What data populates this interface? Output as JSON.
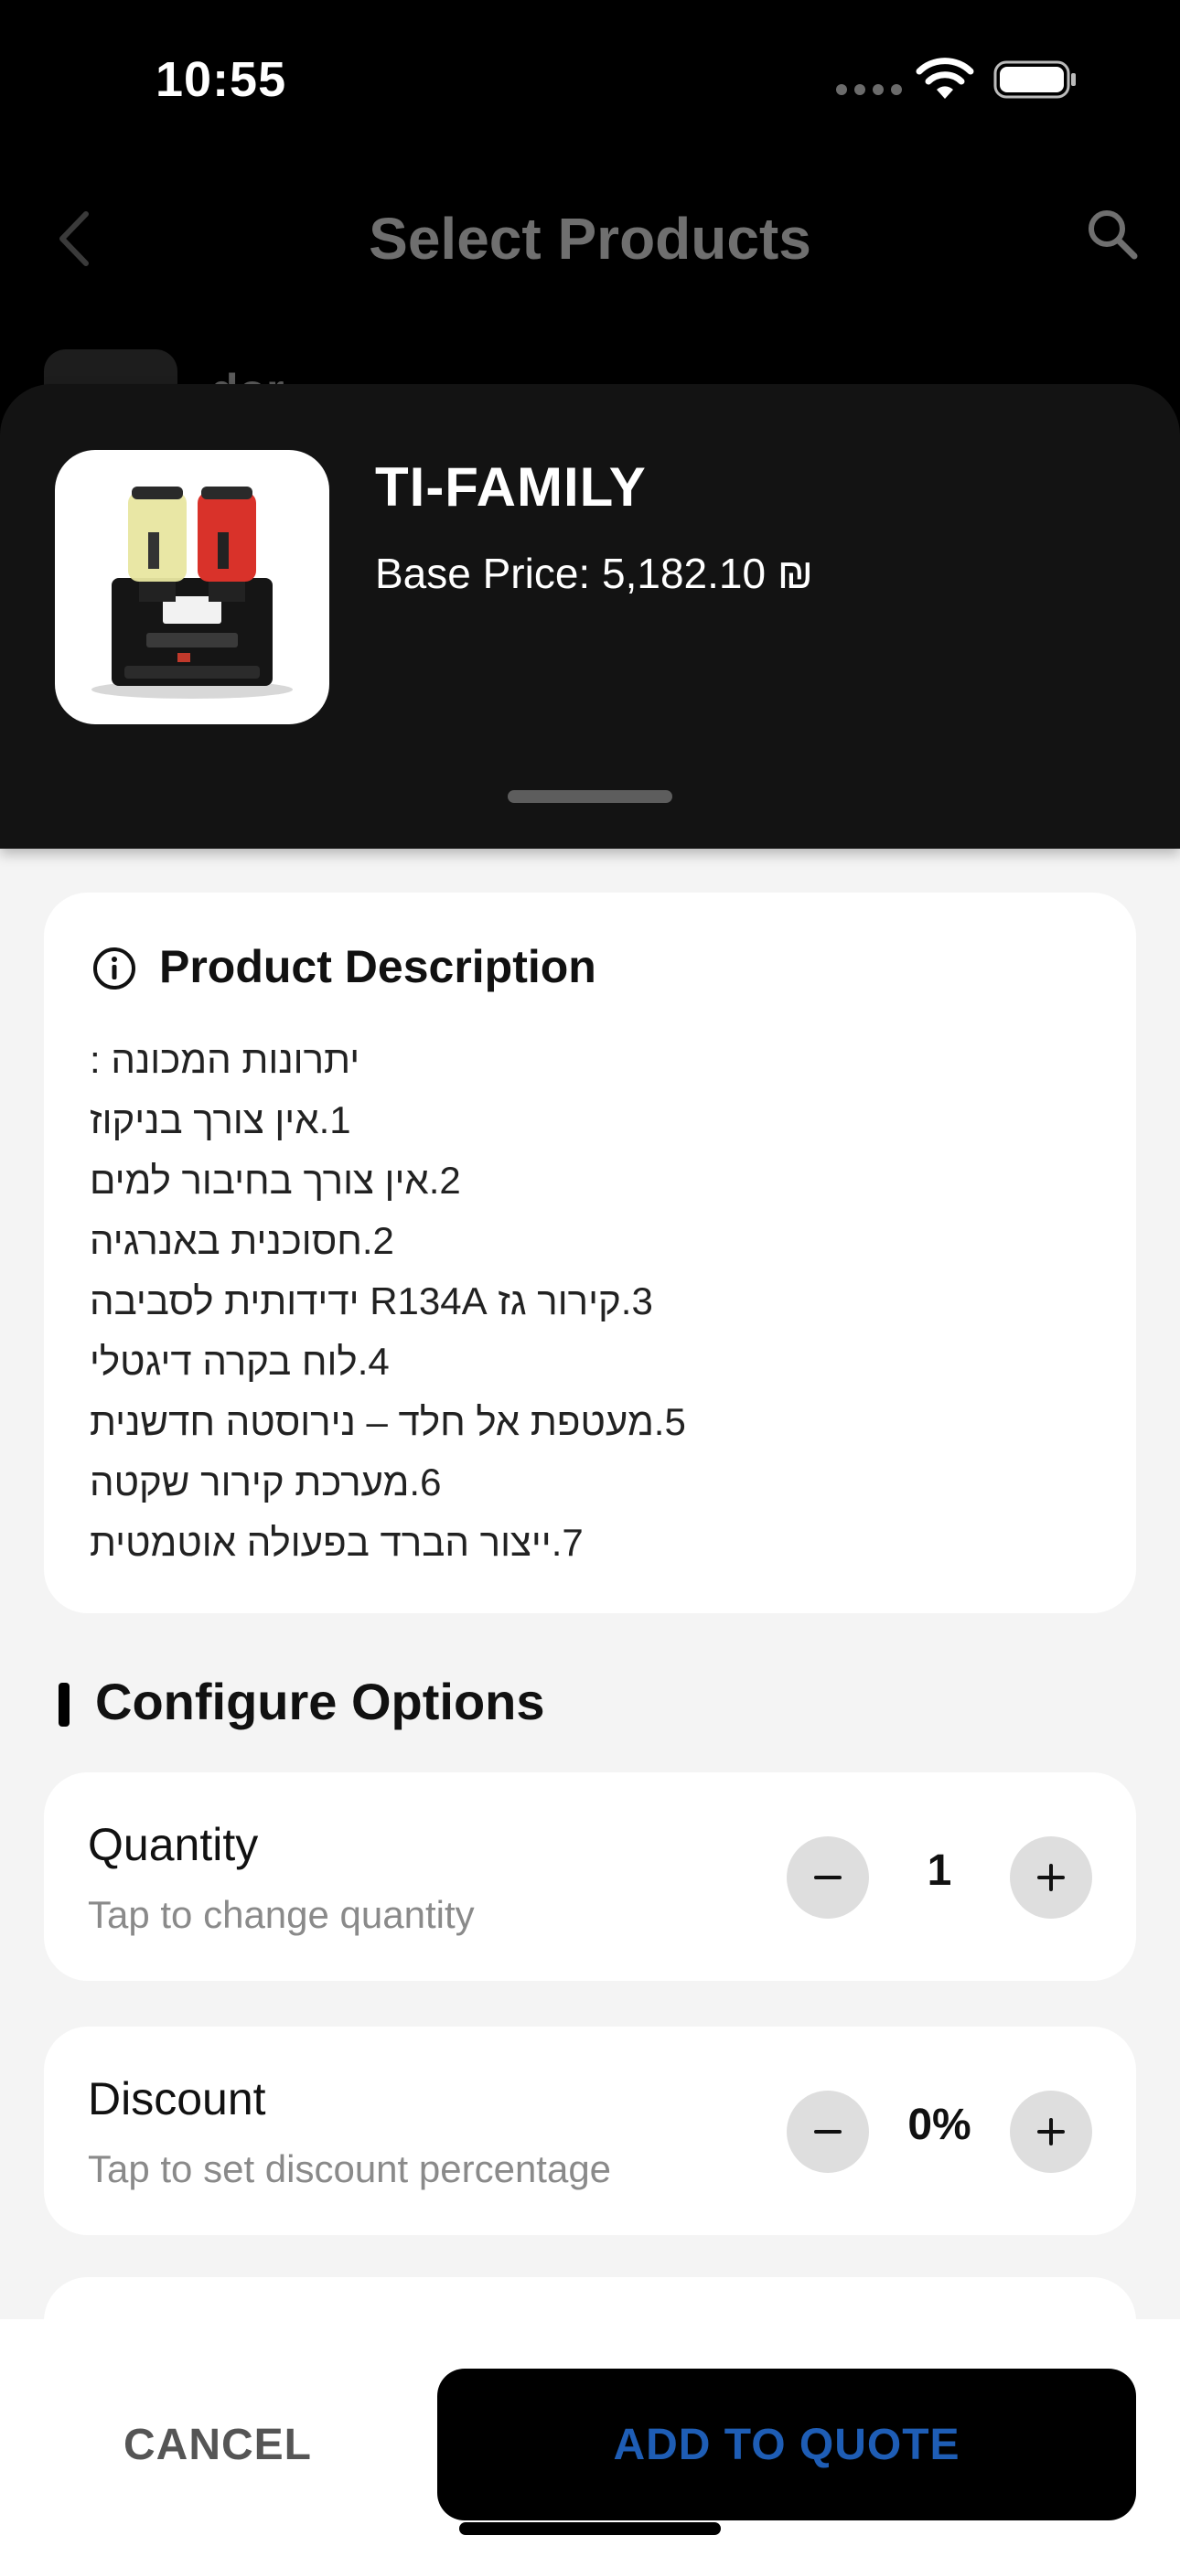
{
  "status_bar": {
    "time": "10:55"
  },
  "nav": {
    "title": "Select Products",
    "back_icon": "chevron-left-icon",
    "search_icon": "search-icon",
    "background_item_name": "dor"
  },
  "product": {
    "name": "TI-FAMILY",
    "base_price": "Base Price: 5,182.10 ₪",
    "image": "slush-machine-image"
  },
  "description": {
    "title": "Product Description",
    "icon": "info-icon",
    "lines": [
      "יתרונות המכונה :",
      "1.אין צורך בניקוז",
      "2.אין צורך בחיבור למים",
      "2.חסוכנית באנרגיה",
      "3.קירור גז R134A ידידותית לסביבה",
      "4.לוח בקרה דיגטלי",
      "5.מעטפת אל חלד – נירוסטה חדשנית",
      "6.מערכת קירור שקטה",
      "7.ייצור הברד בפעולה אוטמטית"
    ]
  },
  "configure": {
    "title": "Configure Options",
    "quantity": {
      "label": "Quantity",
      "hint": "Tap to change quantity",
      "value": "1"
    },
    "discount": {
      "label": "Discount",
      "hint": "Tap to set discount percentage",
      "value": "0%"
    }
  },
  "footer": {
    "cancel_label": "CANCEL",
    "add_label": "ADD TO QUOTE"
  },
  "colors": {
    "accent": "#1e5db5",
    "background": "#f4f4f4",
    "header": "#131313"
  }
}
